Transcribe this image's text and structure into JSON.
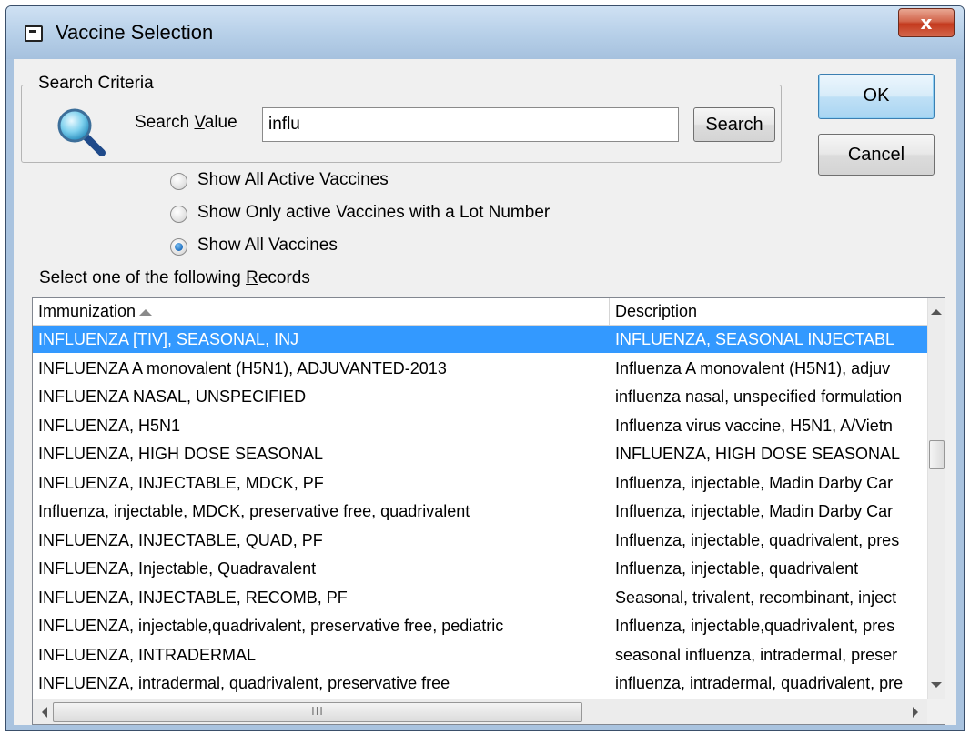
{
  "window": {
    "title": "Vaccine Selection",
    "close_glyph": "x"
  },
  "search": {
    "group_label": "Search Criteria",
    "label_prefix": "Search ",
    "label_mnemonic": "V",
    "label_suffix": "alue",
    "value": "influ",
    "button_label": "Search"
  },
  "buttons": {
    "ok_label": "OK",
    "cancel_label": "Cancel"
  },
  "filters": [
    {
      "label": "Show All Active Vaccines",
      "checked": false
    },
    {
      "label": "Show Only active Vaccines with a Lot Number",
      "checked": false
    },
    {
      "label": "Show All Vaccines",
      "checked": true
    }
  ],
  "records": {
    "label_prefix": "Select one of the following ",
    "label_mnemonic": "R",
    "label_suffix": "ecords",
    "columns": [
      "Immunization",
      "Description"
    ],
    "sort_column": "Immunization",
    "rows": [
      {
        "immunization": "INFLUENZA [TIV], SEASONAL, INJ",
        "description": "INFLUENZA, SEASONAL INJECTABL",
        "selected": true
      },
      {
        "immunization": "INFLUENZA A monovalent (H5N1), ADJUVANTED-2013",
        "description": "Influenza A monovalent (H5N1), adjuv",
        "selected": false
      },
      {
        "immunization": "INFLUENZA NASAL, UNSPECIFIED",
        "description": "influenza nasal, unspecified formulation",
        "selected": false
      },
      {
        "immunization": "INFLUENZA, H5N1",
        "description": "Influenza virus vaccine, H5N1, A/Vietn",
        "selected": false
      },
      {
        "immunization": "INFLUENZA, HIGH DOSE SEASONAL",
        "description": "INFLUENZA, HIGH DOSE SEASONAL",
        "selected": false
      },
      {
        "immunization": "INFLUENZA, INJECTABLE, MDCK, PF",
        "description": "Influenza, injectable, Madin Darby Car",
        "selected": false
      },
      {
        "immunization": "Influenza, injectable, MDCK, preservative free, quadrivalent",
        "description": "Influenza, injectable, Madin Darby Car",
        "selected": false
      },
      {
        "immunization": "INFLUENZA, INJECTABLE, QUAD, PF",
        "description": "Influenza, injectable, quadrivalent, pres",
        "selected": false
      },
      {
        "immunization": "INFLUENZA, Injectable, Quadravalent",
        "description": "Influenza, injectable, quadrivalent",
        "selected": false
      },
      {
        "immunization": "INFLUENZA, INJECTABLE, RECOMB, PF",
        "description": "Seasonal, trivalent, recombinant, inject",
        "selected": false
      },
      {
        "immunization": "INFLUENZA, injectable,quadrivalent, preservative free, pediatric",
        "description": "Influenza, injectable,quadrivalent, pres",
        "selected": false
      },
      {
        "immunization": "INFLUENZA, INTRADERMAL",
        "description": "seasonal influenza, intradermal, preser",
        "selected": false
      },
      {
        "immunization": "INFLUENZA, intradermal, quadrivalent, preservative free",
        "description": "influenza, intradermal, quadrivalent, pre",
        "selected": false
      }
    ]
  },
  "scrollbars": {
    "hscroll_grip": "III"
  },
  "colors": {
    "selection": "#3399ff",
    "title_gradient_top": "#cfe1f3",
    "close_button": "#c4391d"
  }
}
